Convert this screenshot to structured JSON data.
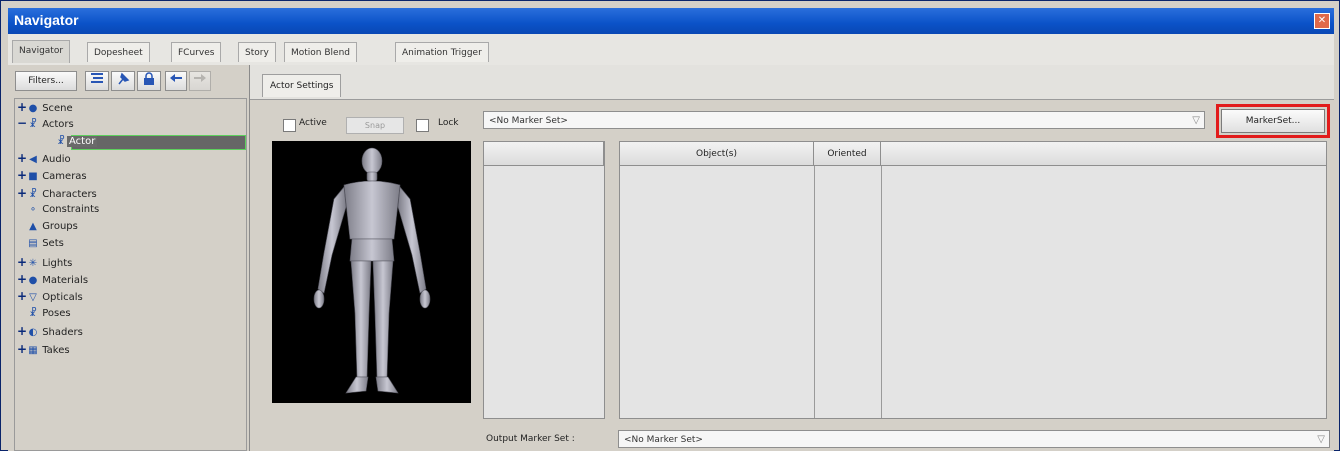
{
  "window": {
    "title": "Navigator",
    "close_icon": "close-icon"
  },
  "tabs": [
    {
      "label": "Navigator"
    },
    {
      "label": "Dopesheet"
    },
    {
      "label": "FCurves"
    },
    {
      "label": "Story"
    },
    {
      "label": "Motion Blend"
    },
    {
      "label": "Animation Trigger"
    }
  ],
  "toolbar": {
    "filters_label": "Filters..."
  },
  "tree": {
    "nodes": [
      {
        "label": "Scene",
        "icon": "scene-icon",
        "expander": "+"
      },
      {
        "label": "Actors",
        "icon": "actor-icon",
        "expander": "−"
      },
      {
        "label": "Actor",
        "icon": "actor-icon",
        "expander": ""
      },
      {
        "label": "Audio",
        "icon": "audio-icon",
        "expander": "+"
      },
      {
        "label": "Cameras",
        "icon": "camera-icon",
        "expander": "+"
      },
      {
        "label": "Characters",
        "icon": "character-icon",
        "expander": "+"
      },
      {
        "label": "Constraints",
        "icon": "constraint-icon",
        "expander": ""
      },
      {
        "label": "Groups",
        "icon": "group-icon",
        "expander": ""
      },
      {
        "label": "Sets",
        "icon": "set-icon",
        "expander": ""
      },
      {
        "label": "Lights",
        "icon": "light-icon",
        "expander": "+"
      },
      {
        "label": "Materials",
        "icon": "material-icon",
        "expander": "+"
      },
      {
        "label": "Opticals",
        "icon": "optical-icon",
        "expander": "+"
      },
      {
        "label": "Poses",
        "icon": "pose-icon",
        "expander": ""
      },
      {
        "label": "Shaders",
        "icon": "shader-icon",
        "expander": "+"
      },
      {
        "label": "Takes",
        "icon": "take-icon",
        "expander": "+"
      }
    ]
  },
  "actor_settings": {
    "tab_label": "Actor Settings",
    "active_label": "Active",
    "snap_label": "Snap",
    "lock_label": "Lock",
    "marker_set_value": "<No Marker Set>",
    "markerset_button": "MarkerSet...",
    "columns": {
      "objects": "Object(s)",
      "oriented": "Oriented"
    },
    "output_marker_set_label": "Output Marker Set :",
    "output_marker_set_value": "<No Marker Set>"
  },
  "colors": {
    "titlebar": "#0b52c8",
    "highlight": "#e21b1b",
    "viewport_bg": "#000000"
  }
}
